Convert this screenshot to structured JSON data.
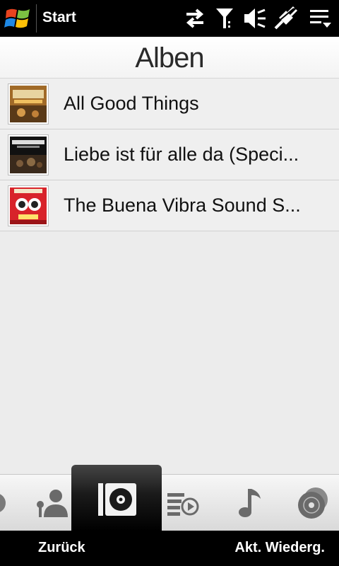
{
  "status_bar": {
    "start_label": "Start",
    "icons": [
      "data-transfer-icon",
      "signal-icon",
      "volume-icon",
      "power-plug-icon",
      "menu-icon"
    ]
  },
  "header": {
    "title": "Alben"
  },
  "albums": [
    {
      "title": "All Good Things",
      "cover": "album-cover-1"
    },
    {
      "title": "Liebe ist für alle da (Speci...",
      "cover": "album-cover-2"
    },
    {
      "title": "The Buena Vibra Sound S...",
      "cover": "album-cover-3"
    }
  ],
  "tabs": [
    "disc-partial-icon",
    "artist-icon",
    "album-icon",
    "playlist-icon",
    "music-note-icon",
    "genre-discs-icon"
  ],
  "active_tab": "album-icon",
  "softkeys": {
    "left": "Zurück",
    "right": "Akt. Wiederg."
  },
  "colors": {
    "bar_background": "#000000",
    "content_background": "#ececec"
  }
}
